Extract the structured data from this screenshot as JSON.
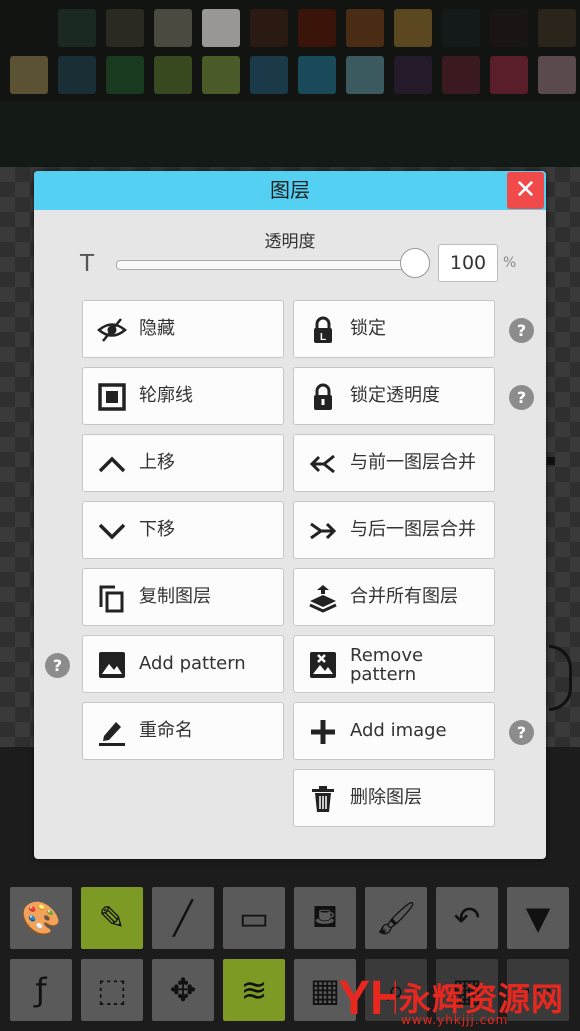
{
  "dialog": {
    "title": "图层",
    "opacity": {
      "label": "透明度",
      "t_icon": "T",
      "value": "100",
      "unit": "%",
      "level": 1.0
    },
    "buttons": [
      {
        "label": "隐藏",
        "icon": "eye-slash-icon"
      },
      {
        "label": "锁定",
        "icon": "lock-icon"
      },
      {
        "label": "轮廓线",
        "icon": "outline-square-icon"
      },
      {
        "label": "锁定透明度",
        "icon": "lock-icon"
      },
      {
        "label": "上移",
        "icon": "chevron-up-icon"
      },
      {
        "label": "与前一图层合并",
        "icon": "merge-previous-icon"
      },
      {
        "label": "下移",
        "icon": "chevron-down-icon"
      },
      {
        "label": "与后一图层合并",
        "icon": "merge-next-icon"
      },
      {
        "label": "复制图层",
        "icon": "copy-icon"
      },
      {
        "label": "合并所有图层",
        "icon": "layers-merge-icon"
      },
      {
        "label": "Add pattern",
        "icon": "image-icon"
      },
      {
        "label": "Remove pattern",
        "icon": "image-remove-icon"
      },
      {
        "label": "重命名",
        "icon": "pencil-icon"
      },
      {
        "label": "Add image",
        "icon": "plus-icon"
      },
      {
        "label": "删除图层",
        "icon": "trash-icon"
      }
    ],
    "help_glyph": "?",
    "close_glyph": "✕"
  },
  "palette": [
    "#1a2a20",
    "#2a2a22",
    "#4a4a40",
    "#9a9896",
    "#2a1a12",
    "#3a1408",
    "#4a2c14",
    "#5c4820",
    "#141a1a",
    "#1a1414",
    "#2a241a",
    "#5a5232",
    "#1a2e36",
    "#1a3a20",
    "#3a4a20",
    "#4a5a28",
    "#1a3a4a",
    "#1a4a5a",
    "#3a5a60",
    "#241a2a",
    "#3a1a1e",
    "#5a1e2a",
    "#5a4a4c"
  ],
  "toolbar": {
    "icons": [
      "palette-icon",
      "pencil-icon",
      "eyedropper-icon",
      "eraser-icon",
      "fill-bucket-icon",
      "brush-icon",
      "undo-icon",
      "dropdown-icon",
      "fx-icon",
      "transform-icon",
      "move-icon",
      "layers-icon",
      "film-icon",
      "zoom-icon",
      "grid-icon",
      "more-icon"
    ],
    "fx_glyph": "ƒ"
  },
  "watermark": {
    "text": "永辉资源网",
    "url": "www.yhkjjj.com",
    "logo_text": "YH"
  }
}
